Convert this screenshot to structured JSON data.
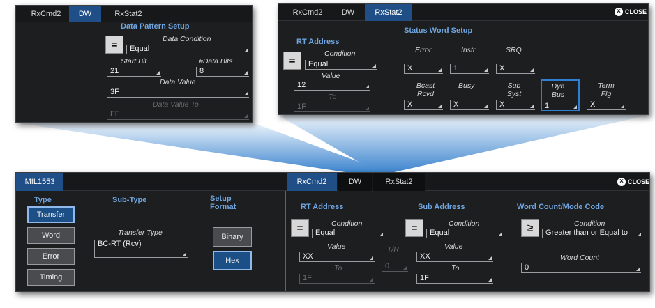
{
  "dw_panel": {
    "tabs": [
      "RxCmd2",
      "DW",
      "RxStat2"
    ],
    "title": "Data Pattern Setup",
    "operator_symbol": "=",
    "data_condition": {
      "label": "Data Condition",
      "value": "Equal"
    },
    "start_bit": {
      "label": "Start Bit",
      "value": "21"
    },
    "num_data_bits": {
      "label": "#Data Bits",
      "value": "8"
    },
    "data_value": {
      "label": "Data Value",
      "value": "3F"
    },
    "data_value_to": {
      "label": "Data Value To",
      "value": "FF"
    }
  },
  "rxstat_panel": {
    "tabs": [
      "RxCmd2",
      "DW",
      "RxStat2"
    ],
    "close_label": "CLOSE",
    "rt_address": {
      "title": "RT Address",
      "operator_symbol": "=",
      "condition_label": "Condition",
      "condition_value": "Equal",
      "value_label": "Value",
      "value": "12",
      "to_label": "To",
      "to_value": "1F"
    },
    "status_title": "Status Word Setup",
    "fields": [
      {
        "label": "Error",
        "value": "X"
      },
      {
        "label": "Instr",
        "value": "1"
      },
      {
        "label": "SRQ",
        "value": "X"
      },
      {
        "label": "Bcast Rcvd",
        "value": "X"
      },
      {
        "label": "Busy",
        "value": "X"
      },
      {
        "label": "Sub Syst",
        "value": "X"
      },
      {
        "label": "Dyn Bus",
        "value": "1"
      },
      {
        "label": "Term Flg",
        "value": "X"
      }
    ]
  },
  "main_panel": {
    "left_tab": "MIL1553",
    "tabs": [
      "RxCmd2",
      "DW",
      "RxStat2"
    ],
    "close_label": "CLOSE",
    "type_title": "Type",
    "type_buttons": [
      "Transfer",
      "Word",
      "Error",
      "Timing"
    ],
    "subtype_title": "Sub-Type",
    "transfer_type_label": "Transfer Type",
    "transfer_type_value": "BC-RT (Rcv)",
    "setup_format_title": "Setup Format",
    "format_buttons": [
      "Binary",
      "Hex"
    ],
    "rt_address": {
      "title": "RT Address",
      "operator_symbol": "=",
      "condition_label": "Condition",
      "condition_value": "Equal",
      "value_label": "Value",
      "value": "XX",
      "to_label": "To",
      "to_value": "1F"
    },
    "tr": {
      "label": "T/R",
      "value": "0"
    },
    "sub_address": {
      "title": "Sub Address",
      "operator_symbol": "=",
      "condition_label": "Condition",
      "condition_value": "Equal",
      "value_label": "Value",
      "value": "XX",
      "to_label": "To",
      "to_value": "1F"
    },
    "word_count": {
      "title": "Word Count/Mode Code",
      "operator_symbol": "≥",
      "condition_label": "Condition",
      "condition_value": "Greater than  or Equal to",
      "count_label": "Word Count",
      "count_value": "0"
    }
  },
  "colors": {
    "panel_bg": "#1d1e20",
    "tab_selected": "#1f4f86",
    "heading": "#6fa6e0",
    "beam": "#4f8cc8"
  }
}
